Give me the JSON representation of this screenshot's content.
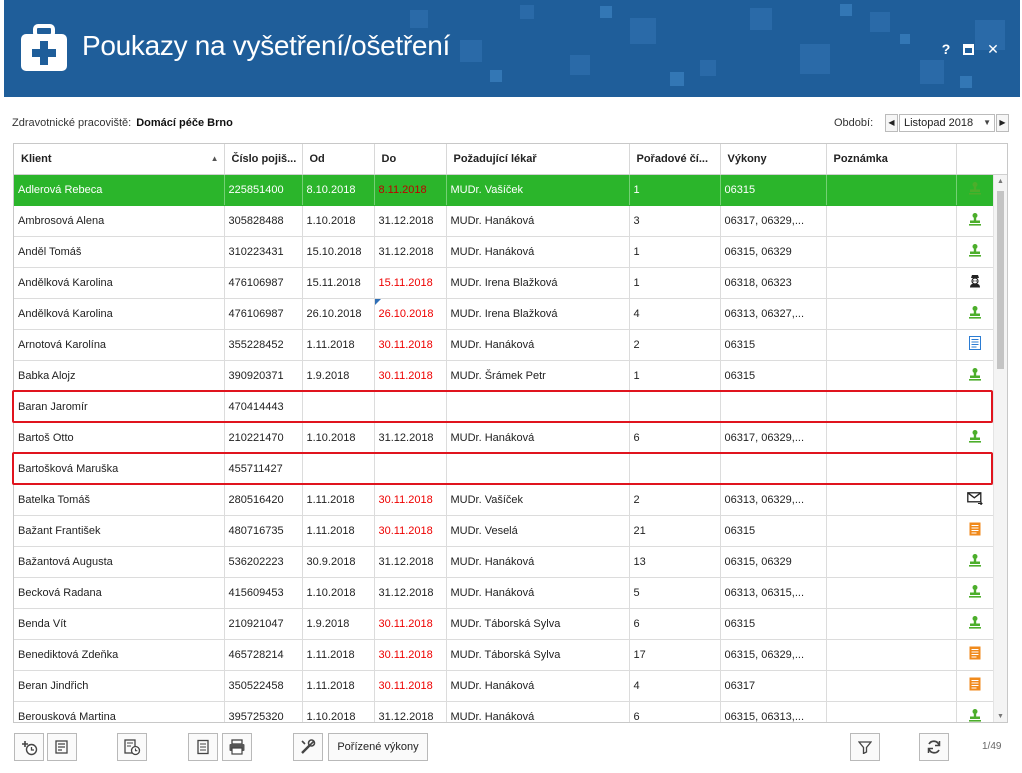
{
  "window": {
    "title": "Poukazy na vyšetření/ošetření",
    "help_label": "?",
    "close_label": "✕"
  },
  "filter": {
    "workplace_label": "Zdravotnické pracoviště:",
    "workplace_value": "Domácí péče Brno",
    "period_label": "Období:",
    "period_value": "Listopad 2018"
  },
  "table": {
    "columns": [
      "Klient",
      "Číslo pojiš...",
      "Od",
      "Do",
      "Požadující lékař",
      "Pořadové čí...",
      "Výkony",
      "Poznámka",
      ""
    ],
    "rows": [
      {
        "klient": "Adlerová Rebeca",
        "cislo": "225851400",
        "od": "8.10.2018",
        "do": "8.11.2018",
        "do_red": true,
        "lekar": "MUDr. Vašíček",
        "poradi": "1",
        "vykony": "06315",
        "poznamka": "",
        "icon": "stamp-green",
        "selected": true
      },
      {
        "klient": "Ambrosová Alena",
        "cislo": "305828488",
        "od": "1.10.2018",
        "do": "31.12.2018",
        "do_red": false,
        "lekar": "MUDr. Hanáková",
        "poradi": "3",
        "vykony": "06317, 06329,...",
        "poznamka": "",
        "icon": "stamp-green"
      },
      {
        "klient": "Anděl Tomáš",
        "cislo": "310223431",
        "od": "15.10.2018",
        "do": "31.12.2018",
        "do_red": false,
        "lekar": "MUDr. Hanáková",
        "poradi": "1",
        "vykony": "06315, 06329",
        "poznamka": "",
        "icon": "stamp-green"
      },
      {
        "klient": "Andělková Karolina",
        "cislo": "476106987",
        "od": "15.11.2018",
        "do": "15.11.2018",
        "do_red": true,
        "lekar": "MUDr. Irena Blažková",
        "poradi": "1",
        "vykony": "06318, 06323",
        "poznamka": "",
        "icon": "agent"
      },
      {
        "klient": "Andělková Karolina",
        "cislo": "476106987",
        "od": "26.10.2018",
        "do": "26.10.2018",
        "do_red": true,
        "corner": true,
        "lekar": "MUDr. Irena Blažková",
        "poradi": "4",
        "vykony": "06313, 06327,...",
        "poznamka": "",
        "icon": "stamp-green"
      },
      {
        "klient": "Arnotová Karolína",
        "cislo": "355228452",
        "od": "1.11.2018",
        "do": "30.11.2018",
        "do_red": true,
        "lekar": "MUDr. Hanáková",
        "poradi": "2",
        "vykony": "06315",
        "poznamka": "",
        "icon": "doc-blue"
      },
      {
        "klient": "Babka Alojz",
        "cislo": "390920371",
        "od": "1.9.2018",
        "do": "30.11.2018",
        "do_red": true,
        "lekar": "MUDr. Šrámek Petr",
        "poradi": "1",
        "vykony": "06315",
        "poznamka": "",
        "icon": "stamp-green"
      },
      {
        "klient": "Baran Jaromír",
        "cislo": "470414443",
        "od": "",
        "do": "",
        "do_red": false,
        "lekar": "",
        "poradi": "",
        "vykony": "",
        "poznamka": "",
        "icon": ""
      },
      {
        "klient": "Bartoš Otto",
        "cislo": "210221470",
        "od": "1.10.2018",
        "do": "31.12.2018",
        "do_red": false,
        "lekar": "MUDr. Hanáková",
        "poradi": "6",
        "vykony": "06317, 06329,...",
        "poznamka": "",
        "icon": "stamp-green"
      },
      {
        "klient": "Bartošková Maruška",
        "cislo": "455711427",
        "od": "",
        "do": "",
        "do_red": false,
        "lekar": "",
        "poradi": "",
        "vykony": "",
        "poznamka": "",
        "icon": ""
      },
      {
        "klient": "Batelka Tomáš",
        "cislo": "280516420",
        "od": "1.11.2018",
        "do": "30.11.2018",
        "do_red": true,
        "lekar": "MUDr. Vašíček",
        "poradi": "2",
        "vykony": "06313, 06329,...",
        "poznamka": "",
        "icon": "envelope"
      },
      {
        "klient": "Bažant František",
        "cislo": "480716735",
        "od": "1.11.2018",
        "do": "30.11.2018",
        "do_red": true,
        "lekar": "MUDr. Veselá",
        "poradi": "21",
        "vykony": "06315",
        "poznamka": "",
        "icon": "doc-orange"
      },
      {
        "klient": "Bažantová Augusta",
        "cislo": "536202223",
        "od": "30.9.2018",
        "do": "31.12.2018",
        "do_red": false,
        "lekar": "MUDr. Hanáková",
        "poradi": "13",
        "vykony": "06315, 06329",
        "poznamka": "",
        "icon": "stamp-green"
      },
      {
        "klient": "Becková Radana",
        "cislo": "415609453",
        "od": "1.10.2018",
        "do": "31.12.2018",
        "do_red": false,
        "lekar": "MUDr. Hanáková",
        "poradi": "5",
        "vykony": "06313, 06315,...",
        "poznamka": "",
        "icon": "stamp-green"
      },
      {
        "klient": "Benda Vít",
        "cislo": "210921047",
        "od": "1.9.2018",
        "do": "30.11.2018",
        "do_red": true,
        "lekar": "MUDr. Táborská Sylva",
        "poradi": "6",
        "vykony": "06315",
        "poznamka": "",
        "icon": "stamp-green"
      },
      {
        "klient": "Benediktová Zdeňka",
        "cislo": "465728214",
        "od": "1.11.2018",
        "do": "30.11.2018",
        "do_red": true,
        "lekar": "MUDr. Táborská Sylva",
        "poradi": "17",
        "vykony": "06315, 06329,...",
        "poznamka": "",
        "icon": "doc-orange"
      },
      {
        "klient": "Beran Jindřich",
        "cislo": "350522458",
        "od": "1.11.2018",
        "do": "30.11.2018",
        "do_red": true,
        "lekar": "MUDr. Hanáková",
        "poradi": "4",
        "vykony": "06317",
        "poznamka": "",
        "icon": "doc-orange"
      },
      {
        "klient": "Berousková Martina",
        "cislo": "395725320",
        "od": "1.10.2018",
        "do": "31.12.2018",
        "do_red": false,
        "lekar": "MUDr. Hanáková",
        "poradi": "6",
        "vykony": "06315, 06313,...",
        "poznamka": "",
        "icon": "stamp-green"
      }
    ]
  },
  "toolbar": {
    "services_button_label": "Pořízené výkony",
    "pager": "1/49"
  },
  "colors": {
    "header_bg": "#1f5e9a",
    "selected_row": "#2bb52b",
    "date_red": "#e00000",
    "highlight_box": "#e0141e"
  }
}
